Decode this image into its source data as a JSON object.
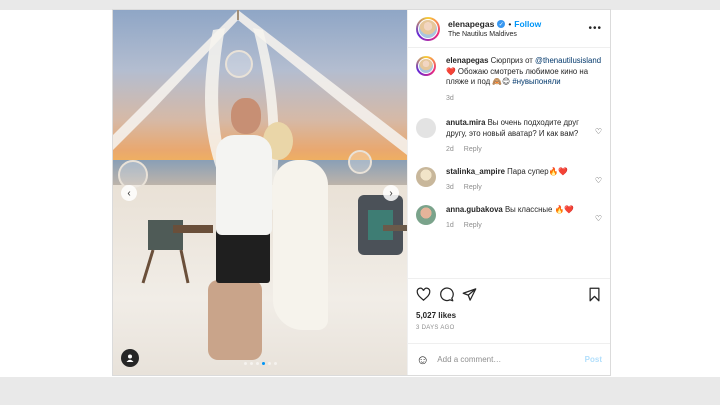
{
  "post": {
    "author": "elenapegas",
    "follow_label": "Follow",
    "location": "The Nautilus Maldives",
    "more_label": "•••",
    "caption": {
      "user": "elenapegas",
      "text_1": "Сюрприз от",
      "mention": "@thenautilusisland",
      "text_2": "❤️ Обожаю смотреть любимое кино на пляже и под",
      "emoji": "🙈😊",
      "hashtag": "#нувыпоняли",
      "time": "3d"
    },
    "comments": [
      {
        "user": "anuta.mira",
        "text": "Вы очень подходите друг другу, это новый аватар? И как вам?",
        "time": "2d",
        "reply": "Reply"
      },
      {
        "user": "stalinka_ampire",
        "text": "Пара супер🔥❤️",
        "time": "3d",
        "reply": "Reply"
      },
      {
        "user": "anna.gubakova",
        "text": "Вы классные 🔥❤️",
        "time": "1d",
        "reply": "Reply"
      }
    ],
    "likes": "5,027 likes",
    "date": "3 DAYS AGO",
    "add_comment_placeholder": "Add a comment…",
    "post_button": "Post",
    "carousel": {
      "prev": "‹",
      "next": "›",
      "dots": 6,
      "active_dot": 3
    }
  },
  "icons": [
    "heart-icon",
    "comment-icon",
    "share-icon",
    "bookmark-icon",
    "smile-icon",
    "verified-icon",
    "user-tag-icon"
  ],
  "colors": {
    "accent": "#0095f6",
    "verified": "#3897f0",
    "text": "#262626",
    "muted": "#8e8e8e"
  }
}
